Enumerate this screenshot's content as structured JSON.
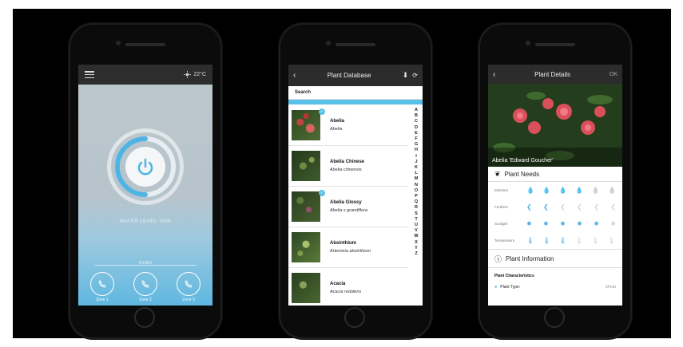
{
  "phone1": {
    "temperature": "22°C",
    "water_level": "WATER LEVEL: 50%",
    "zones_label": "ZONES",
    "zones": [
      "Zone 1",
      "Zone 2",
      "Zone 3"
    ],
    "water_level_fraction": 0.5
  },
  "phone2": {
    "title": "Plant Database",
    "search_placeholder": "Search",
    "plants": [
      {
        "name": "Abelia",
        "latin": "Abelia",
        "selected": true
      },
      {
        "name": "Abelia Chinese",
        "latin": "Abelia chinensis",
        "selected": false
      },
      {
        "name": "Abelia Glossy",
        "latin": "Abelia x grandiflora",
        "selected": true
      },
      {
        "name": "Absinthium",
        "latin": "Artemisia absinthium",
        "selected": false
      },
      {
        "name": "Acacia",
        "latin": "Acacia redolens",
        "selected": false
      }
    ],
    "alphabet": [
      "A",
      "B",
      "C",
      "D",
      "E",
      "F",
      "G",
      "H",
      "I",
      "J",
      "K",
      "L",
      "M",
      "N",
      "O",
      "P",
      "Q",
      "R",
      "S",
      "T",
      "U",
      "V",
      "W",
      "X",
      "Y",
      "Z"
    ]
  },
  "phone3": {
    "title": "Plant Details",
    "ok": "OK",
    "photo_caption": "Abelia 'Edward Goucher'",
    "needs_title": "Plant Needs",
    "needs": [
      {
        "label": "Moisture",
        "icon": "droplet-icon",
        "level": 4,
        "of": 6
      },
      {
        "label": "Fertilizer",
        "icon": "leaf-icon",
        "level": 2,
        "of": 6
      },
      {
        "label": "Sunlight",
        "icon": "sun-icon",
        "level": 5,
        "of": 6
      },
      {
        "label": "Temperature",
        "icon": "thermometer-icon",
        "level": 3,
        "of": 6
      }
    ],
    "info_title": "Plant Information",
    "characteristics": "Plant Characteristics",
    "plant_type_label": "Plant Type:",
    "plant_type_value": "Shrub"
  },
  "colors": {
    "accent": "#5bc0e8",
    "dark": "#2c2c2c"
  }
}
